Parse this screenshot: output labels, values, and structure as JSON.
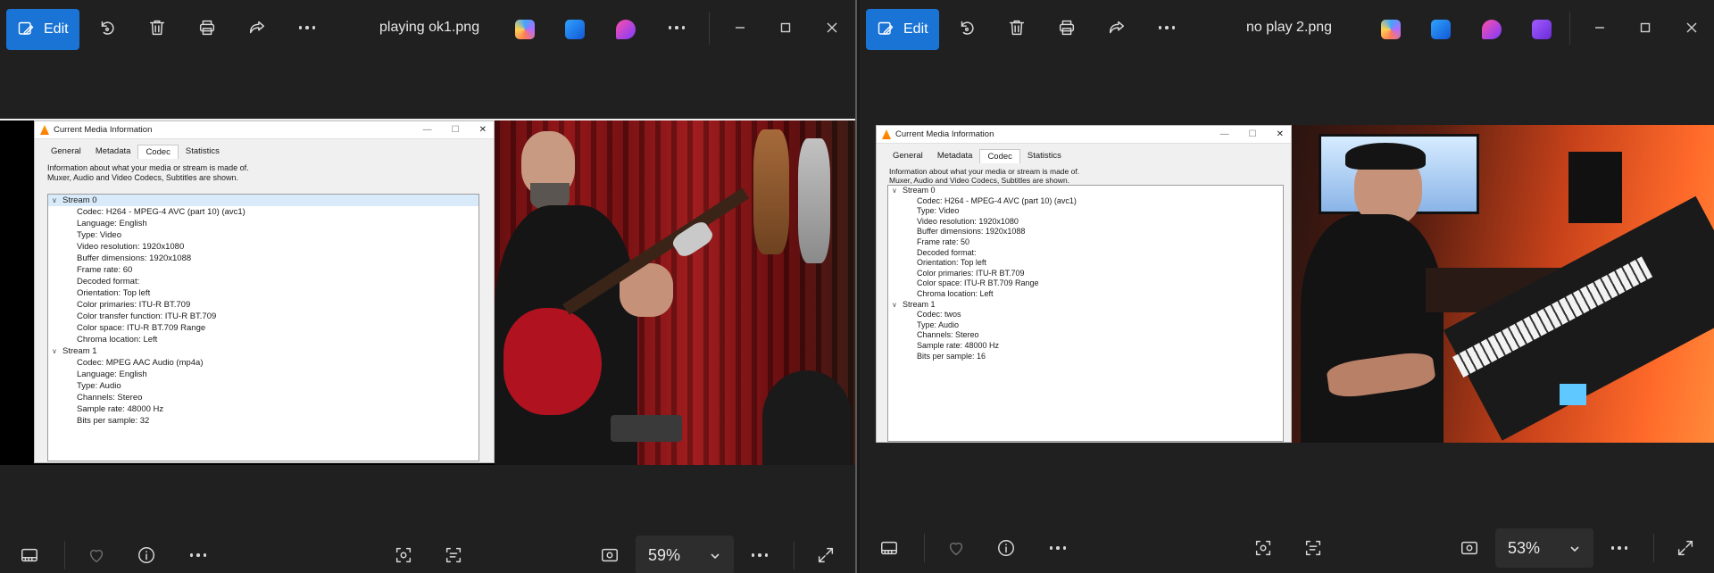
{
  "left": {
    "edit_label": "Edit",
    "file_name": "playing ok1.png",
    "zoom": "59%",
    "vlc": {
      "window_title": "Current Media Information",
      "tabs": [
        "General",
        "Metadata",
        "Codec",
        "Statistics"
      ],
      "active_tab": "Codec",
      "description_line1": "Information about what your media or stream is made of.",
      "description_line2": "Muxer, Audio and Video Codecs, Subtitles are shown.",
      "streams": [
        {
          "name": "Stream 0",
          "rows": [
            "Codec: H264 - MPEG-4 AVC (part 10) (avc1)",
            "Language: English",
            "Type: Video",
            "Video resolution: 1920x1080",
            "Buffer dimensions: 1920x1088",
            "Frame rate: 60",
            "Decoded format:",
            "Orientation: Top left",
            "Color primaries: ITU-R BT.709",
            "Color transfer function: ITU-R BT.709",
            "Color space: ITU-R BT.709 Range",
            "Chroma location: Left"
          ]
        },
        {
          "name": "Stream 1",
          "rows": [
            "Codec: MPEG AAC Audio (mp4a)",
            "Language: English",
            "Type: Audio",
            "Channels: Stereo",
            "Sample rate: 48000 Hz",
            "Bits per sample: 32"
          ]
        }
      ]
    }
  },
  "right": {
    "edit_label": "Edit",
    "file_name": "no play 2.png",
    "zoom": "53%",
    "vlc": {
      "window_title": "Current Media Information",
      "tabs": [
        "General",
        "Metadata",
        "Codec",
        "Statistics"
      ],
      "active_tab": "Codec",
      "description_line1": "Information about what your media or stream is made of.",
      "description_line2": "Muxer, Audio and Video Codecs, Subtitles are shown.",
      "streams": [
        {
          "name": "Stream 0",
          "rows": [
            "Codec: H264 - MPEG-4 AVC (part 10) (avc1)",
            "Type: Video",
            "Video resolution: 1920x1080",
            "Buffer dimensions: 1920x1088",
            "Frame rate: 50",
            "Decoded format:",
            "Orientation: Top left",
            "Color primaries: ITU-R BT.709",
            "Color space: ITU-R BT.709 Range",
            "Chroma location: Left"
          ]
        },
        {
          "name": "Stream 1",
          "rows": [
            "Codec: twos",
            "Type: Audio",
            "Channels: Stereo",
            "Sample rate: 48000 Hz",
            "Bits per sample: 16"
          ]
        }
      ]
    }
  },
  "colors": {
    "accent": "#1a74d6",
    "background": "#202020",
    "zoom_box": "#2d2d2d"
  },
  "icons": {
    "toolbar": [
      "edit-icon",
      "rotate-icon",
      "delete-icon",
      "print-icon",
      "share-icon",
      "more-icon",
      "copilot-icon",
      "designer-icon",
      "clipchamp-icon"
    ],
    "window": [
      "minimize-icon",
      "maximize-icon",
      "close-icon"
    ],
    "bottom": [
      "filmstrip-icon",
      "favorite-icon",
      "info-icon",
      "more-icon",
      "visual-search-icon",
      "text-scan-icon",
      "actual-size-icon",
      "zoom-chevron-icon",
      "fullscreen-icon"
    ]
  }
}
